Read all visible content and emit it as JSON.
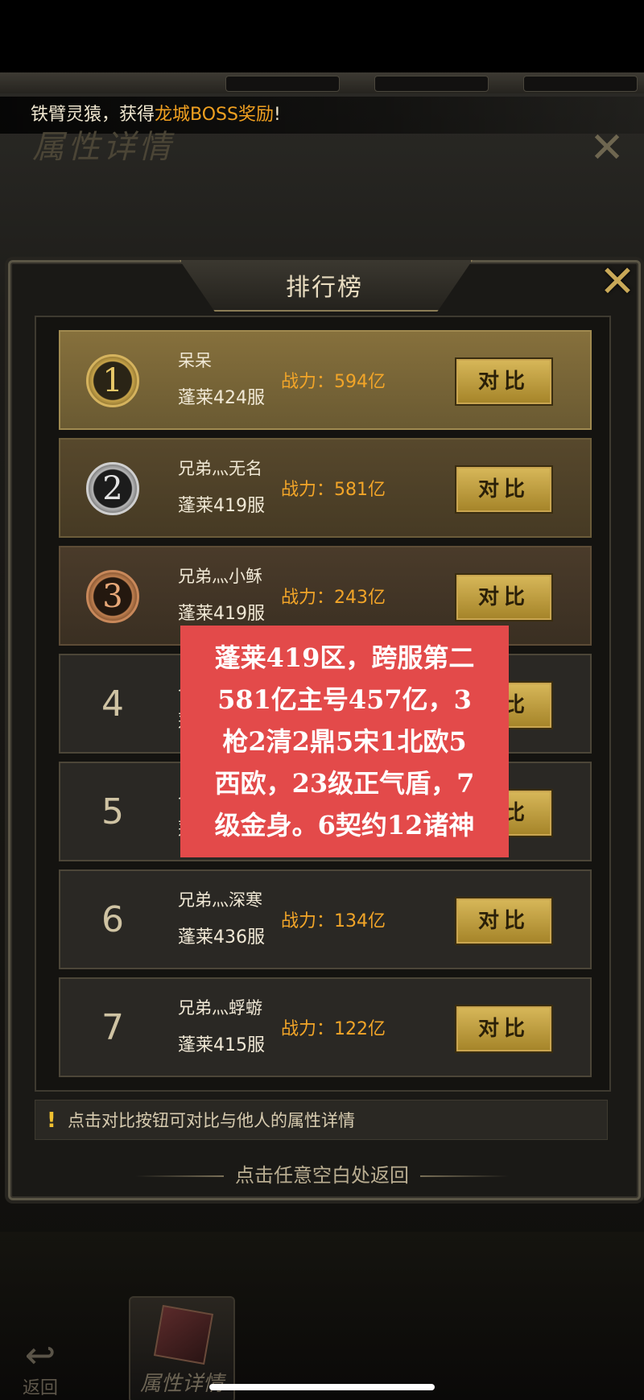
{
  "announcement": {
    "prefix": "铁臂灵猿，获得",
    "highlight": "龙城BOSS奖励",
    "suffix": "!"
  },
  "background": {
    "title": "属性详情"
  },
  "panel": {
    "title": "排行榜"
  },
  "compare_label": "对比",
  "rankings": [
    {
      "rank": "1",
      "name": "呆呆",
      "server": "蓬莱424服",
      "power": "战力：594亿"
    },
    {
      "rank": "2",
      "name": "兄弟灬无名",
      "server": "蓬莱419服",
      "power": "战力：581亿"
    },
    {
      "rank": "3",
      "name": "兄弟灬小稣",
      "server": "蓬莱419服",
      "power": "战力：243亿"
    },
    {
      "rank": "4",
      "name": "兄",
      "server": "蓬",
      "power": ""
    },
    {
      "rank": "5",
      "name": "兄",
      "server": "蓬",
      "power": ""
    },
    {
      "rank": "6",
      "name": "兄弟灬深寒",
      "server": "蓬莱436服",
      "power": "战力：134亿"
    },
    {
      "rank": "7",
      "name": "兄弟灬蜉蝣",
      "server": "蓬莱415服",
      "power": "战力：122亿"
    }
  ],
  "tip": {
    "icon": "!",
    "text": "点击对比按钮可对比与他人的属性详情"
  },
  "back_hint": "点击任意空白处返回",
  "bottom_bar": {
    "back_label": "返回",
    "attr_label": "属性详情"
  },
  "overlay": {
    "lines": [
      "蓬莱419区，跨服第二",
      "581亿主号457亿，3",
      "枪2清2鼎5宋1北欧5",
      "西欧，23级正气盾，7",
      "级金身。6契约12诸神"
    ]
  },
  "icons": {
    "close": "close-x-icon",
    "warning": "exclamation-icon",
    "back": "back-arrow-icon",
    "attr": "treasure-box-icon"
  },
  "colors": {
    "gold_text": "#f2a528",
    "overlay_bg": "#e34a4a",
    "button_gold": "#d8b85a"
  }
}
